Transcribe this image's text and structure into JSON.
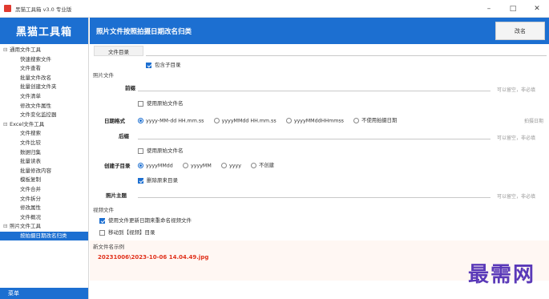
{
  "window": {
    "title": "黑猫工具箱 v3.0 专业版",
    "controls": [
      "–",
      "□",
      "✕"
    ]
  },
  "sidebar": {
    "brand": "黑猫工具箱",
    "groups": [
      {
        "label": "通用文件工具",
        "items": [
          "快速搜索文件",
          "文件查看",
          "批量文件改名",
          "批量创建文件夹",
          "文件清单",
          "修改文件属性",
          "文件变化监控器"
        ]
      },
      {
        "label": "Excel文件工具",
        "items": [
          "文件搜索",
          "文件比较",
          "数据归集",
          "批量读表",
          "批量修改内容",
          "模板复制",
          "文件合并",
          "文件拆分",
          "修改属性",
          "文件概况"
        ]
      },
      {
        "label": "照片文件工具",
        "items": [
          "按拍摄日期改名归类"
        ]
      }
    ],
    "bottom_label": "菜单"
  },
  "header": {
    "title": "照片文件按照拍摄日期改名归类",
    "rename_button": "改名"
  },
  "form": {
    "folder_label": "文件目录",
    "include_subdirs": "包含子目录",
    "photo_section": "照片文件",
    "prefix_label": "前缀",
    "use_orig_name_1": "使用原始文件名",
    "date_format_label": "日期格式",
    "date_formats": [
      "yyyy-MM-dd HH.mm.ss",
      "yyyyMMdd HH.mm.ss",
      "yyyyMMddHHmmss",
      "不使用拍摄日期"
    ],
    "suffix_label": "后缀",
    "use_orig_name_2": "使用原始文件名",
    "subdir_label": "创建子目录",
    "subdir_formats": [
      "yyyyMMdd",
      "yyyyMM",
      "yyyy",
      "不创建"
    ],
    "delete_source_dir": "删除原来目录",
    "photo_subject_label": "照片主题",
    "hint_prefix": "可以留空，非必填",
    "hint_suffix": "可以留空，非必填",
    "hint_subject": "可以留空，非必填",
    "hint_date": "拍摄日期",
    "video_section": "视频文件",
    "video_rename": "使用文件更新日期来重命名视频文件",
    "video_move": "移动到【视频】目录",
    "preview_label": "新文件名示例",
    "preview_value": "20231006\\2023-10-06 14.04.49.jpg"
  },
  "watermark": "最需网",
  "colors": {
    "accent": "#1c6fd1",
    "preview_text": "#e0311b",
    "watermark": "#5a39b8"
  }
}
